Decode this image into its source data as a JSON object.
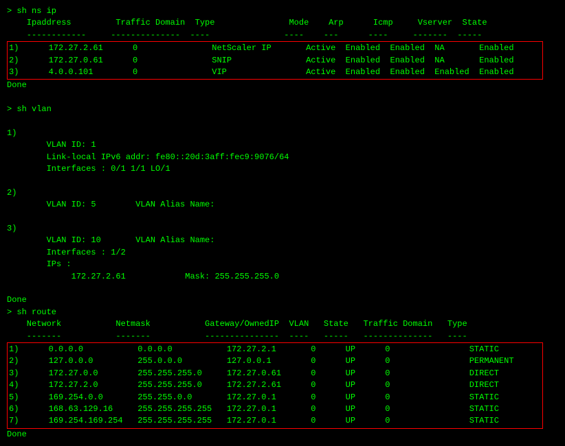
{
  "terminal": {
    "commands": [
      {
        "prompt": "> sh ns ip",
        "headers": "    Ipaddress         Traffic Domain  Type               Mode    Arp      Icmp     Vserver  State",
        "separator": "    ------------     --------------  ----               ----    ---      ----     -------  -----",
        "rows": [
          {
            "num": "1)",
            "ip": "172.27.2.61",
            "td": "0",
            "type": "NetScaler IP",
            "mode": "Active",
            "arp": "Enabled",
            "icmp": "Enabled",
            "vserver": "NA",
            "state": "Enabled"
          },
          {
            "num": "2)",
            "ip": "172.27.0.61",
            "td": "0",
            "type": "SNIP",
            "mode": "Active",
            "arp": "Enabled",
            "icmp": "Enabled",
            "vserver": "NA",
            "state": "Enabled"
          },
          {
            "num": "3)",
            "ip": "4.0.0.101",
            "td": "0",
            "type": "VIP",
            "mode": "Active",
            "arp": "Enabled",
            "icmp": "Enabled",
            "vserver": "Enabled",
            "state": "Enabled"
          }
        ],
        "done": "Done"
      },
      {
        "prompt": "> sh vlan",
        "vlans": [
          {
            "num": "1)",
            "lines": [
              "        VLAN ID: 1",
              "        Link-local IPv6 addr: fe80::20d:3aff:fec9:9076/64",
              "        Interfaces : 0/1 1/1 LO/1"
            ]
          },
          {
            "num": "2)",
            "lines": [
              "        VLAN ID: 5        VLAN Alias Name:"
            ]
          },
          {
            "num": "3)",
            "lines": [
              "        VLAN ID: 10       VLAN Alias Name:",
              "        Interfaces : 1/2",
              "        IPs :",
              "             172.27.2.61            Mask: 255.255.255.0"
            ]
          }
        ],
        "done": "Done"
      },
      {
        "prompt": "> sh route",
        "headers": "    Network           Netmask           Gateway/OwnedIP  VLAN   State   Traffic Domain   Type",
        "separator": "    -------           -------           ---------------  ----   -----   --------------   ----",
        "rows": [
          {
            "num": "1)",
            "network": "0.0.0.0",
            "netmask": "0.0.0.0",
            "gateway": "172.27.2.1",
            "vlan": "0",
            "state": "UP",
            "td": "0",
            "type": "STATIC"
          },
          {
            "num": "2)",
            "network": "127.0.0.0",
            "netmask": "255.0.0.0",
            "gateway": "127.0.0.1",
            "vlan": "0",
            "state": "UP",
            "td": "0",
            "type": "PERMANENT"
          },
          {
            "num": "3)",
            "network": "172.27.0.0",
            "netmask": "255.255.255.0",
            "gateway": "172.27.0.61",
            "vlan": "0",
            "state": "UP",
            "td": "0",
            "type": "DIRECT"
          },
          {
            "num": "4)",
            "network": "172.27.2.0",
            "netmask": "255.255.255.0",
            "gateway": "172.27.2.61",
            "vlan": "0",
            "state": "UP",
            "td": "0",
            "type": "DIRECT"
          },
          {
            "num": "5)",
            "network": "169.254.0.0",
            "netmask": "255.255.0.0",
            "gateway": "172.27.0.1",
            "vlan": "0",
            "state": "UP",
            "td": "0",
            "type": "STATIC"
          },
          {
            "num": "6)",
            "network": "168.63.129.16",
            "netmask": "255.255.255.255",
            "gateway": "172.27.0.1",
            "vlan": "0",
            "state": "UP",
            "td": "0",
            "type": "STATIC"
          },
          {
            "num": "7)",
            "network": "169.254.169.254",
            "netmask": "255.255.255.255",
            "gateway": "172.27.0.1",
            "vlan": "0",
            "state": "UP",
            "td": "0",
            "type": "STATIC"
          }
        ],
        "done": "Done"
      }
    ]
  }
}
